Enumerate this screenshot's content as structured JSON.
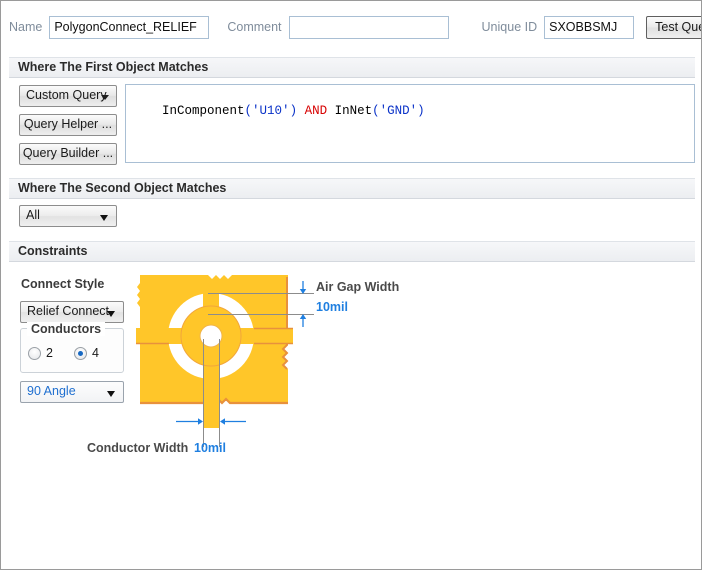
{
  "header": {
    "name_label": "Name",
    "name_value": "PolygonConnect_RELIEF",
    "comment_label": "Comment",
    "comment_value": "",
    "comment_placeholder": "",
    "unique_id_label": "Unique ID",
    "unique_id_value": "SXOBBSMJ",
    "test_queries_label": "Test Queries"
  },
  "first_object": {
    "section_title": "Where The First Object Matches",
    "scope_dropdown": "Custom Query",
    "query_helper_label": "Query Helper ...",
    "query_builder_label": "Query Builder ...",
    "query_tokens": [
      {
        "text": "InComponent",
        "kind": "fn"
      },
      {
        "text": "(",
        "kind": "pun"
      },
      {
        "text": "'U10'",
        "kind": "str"
      },
      {
        "text": ")",
        "kind": "pun"
      },
      {
        "text": " ",
        "kind": "fn"
      },
      {
        "text": "AND",
        "kind": "kw"
      },
      {
        "text": " ",
        "kind": "fn"
      },
      {
        "text": "InNet",
        "kind": "fn"
      },
      {
        "text": "(",
        "kind": "pun"
      },
      {
        "text": "'GND'",
        "kind": "str"
      },
      {
        "text": ")",
        "kind": "pun"
      }
    ],
    "query_text": "InComponent('U10') AND InNet('GND')"
  },
  "second_object": {
    "section_title": "Where The Second Object Matches",
    "scope_dropdown": "All"
  },
  "constraints": {
    "section_title": "Constraints",
    "connect_style_label": "Connect Style",
    "connect_style_value": "Relief Connect",
    "conductors_legend": "Conductors",
    "conductors_options": [
      {
        "label": "2",
        "selected": false
      },
      {
        "label": "4",
        "selected": true
      }
    ],
    "angle_value": "90 Angle",
    "air_gap_label": "Air Gap Width",
    "air_gap_value": "10mil",
    "conductor_width_label": "Conductor Width",
    "conductor_width_value": "10mil"
  },
  "colors": {
    "copper_fill": "#FFC629",
    "copper_edge": "#E8913C",
    "accent_blue": "#1F7FE0",
    "keyword_red": "#D70000",
    "string_blue": "#0A32C8",
    "label_gray": "#4A4A4A",
    "dim_line": "#8C8C8C"
  }
}
